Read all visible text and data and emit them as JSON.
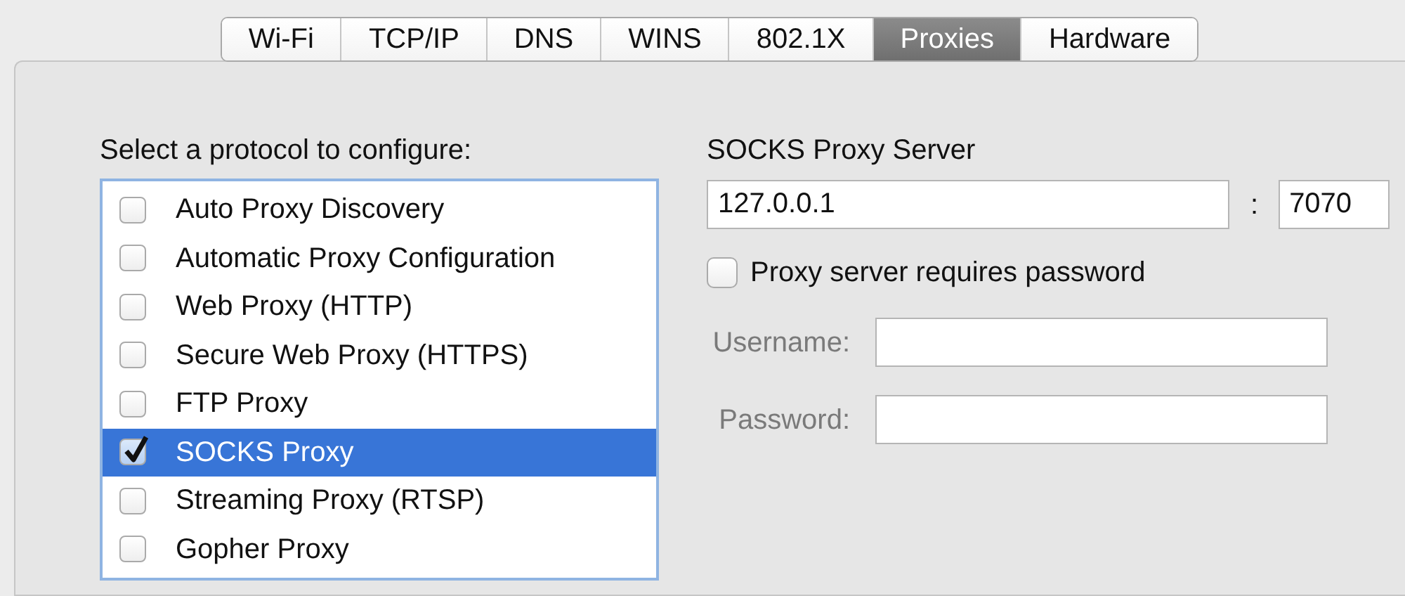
{
  "tabs": [
    {
      "label": "Wi-Fi",
      "selected": false
    },
    {
      "label": "TCP/IP",
      "selected": false
    },
    {
      "label": "DNS",
      "selected": false
    },
    {
      "label": "WINS",
      "selected": false
    },
    {
      "label": "802.1X",
      "selected": false
    },
    {
      "label": "Proxies",
      "selected": true
    },
    {
      "label": "Hardware",
      "selected": false
    }
  ],
  "protocol_list": {
    "label": "Select a protocol to configure:",
    "items": [
      {
        "label": "Auto Proxy Discovery",
        "checked": false,
        "selected": false
      },
      {
        "label": "Automatic Proxy Configuration",
        "checked": false,
        "selected": false
      },
      {
        "label": "Web Proxy (HTTP)",
        "checked": false,
        "selected": false
      },
      {
        "label": "Secure Web Proxy (HTTPS)",
        "checked": false,
        "selected": false
      },
      {
        "label": "FTP Proxy",
        "checked": false,
        "selected": false
      },
      {
        "label": "SOCKS Proxy",
        "checked": true,
        "selected": true
      },
      {
        "label": "Streaming Proxy (RTSP)",
        "checked": false,
        "selected": false
      },
      {
        "label": "Gopher Proxy",
        "checked": false,
        "selected": false
      }
    ]
  },
  "server": {
    "heading": "SOCKS Proxy Server",
    "host": "127.0.0.1",
    "separator": ":",
    "port": "7070",
    "password_required": {
      "label": "Proxy server requires password",
      "checked": false
    },
    "fields": [
      {
        "label": "Username:",
        "disabled": true
      },
      {
        "label": "Password:",
        "disabled": true
      }
    ]
  }
}
